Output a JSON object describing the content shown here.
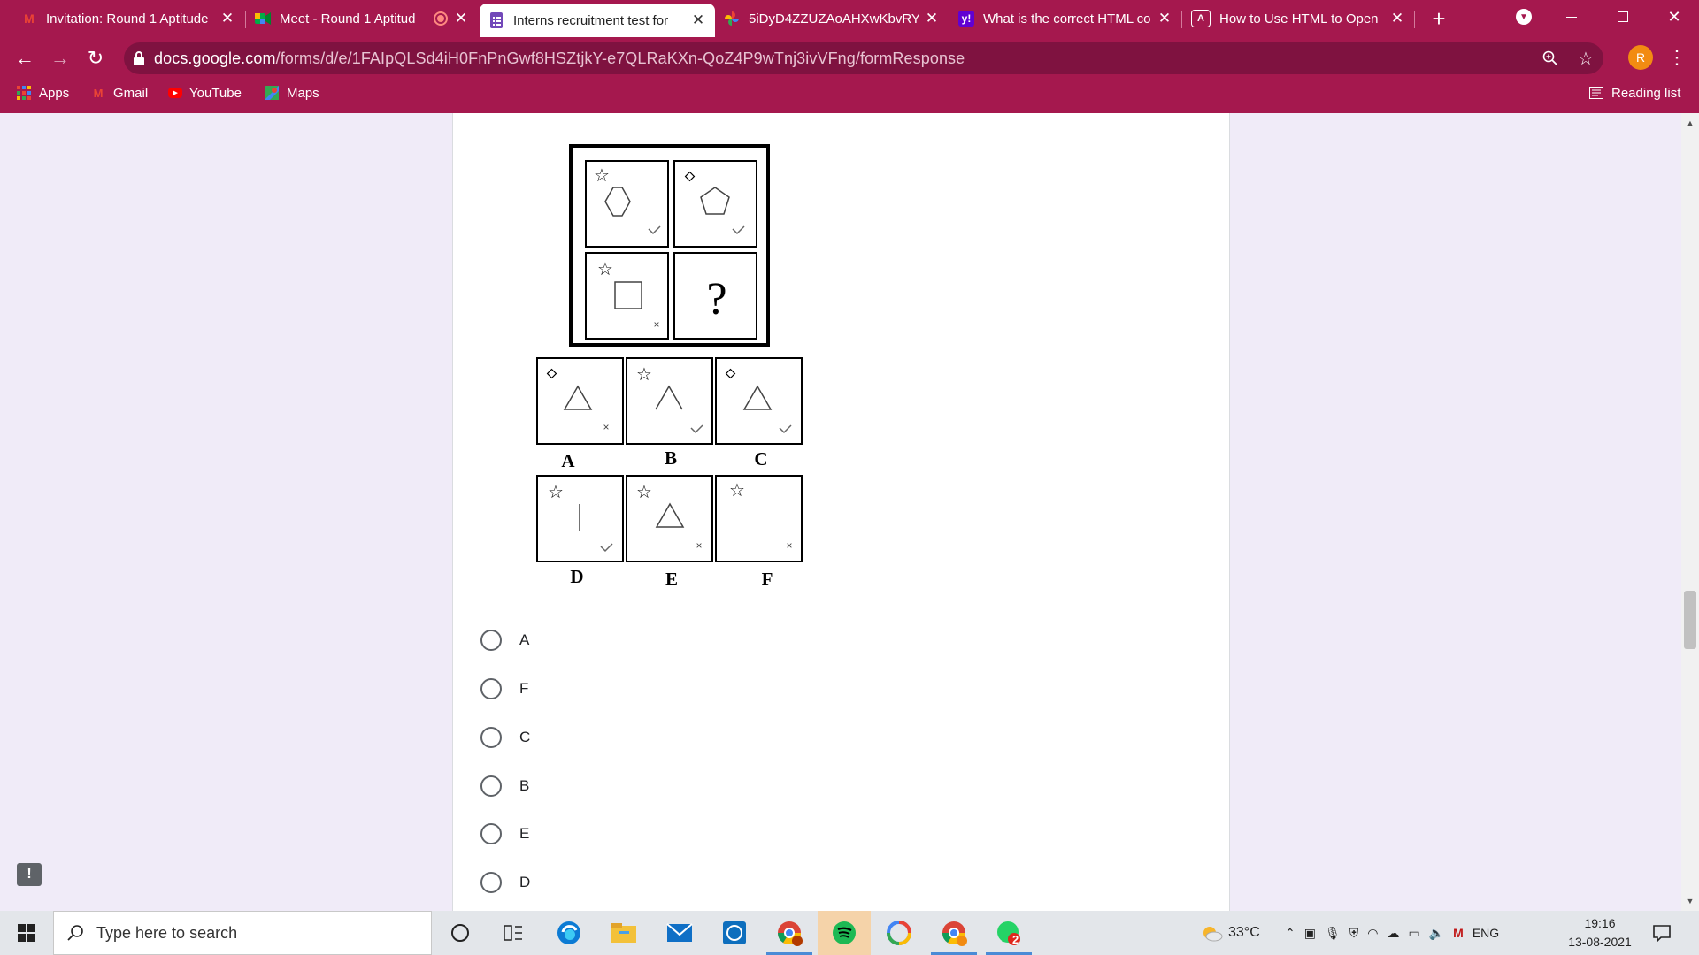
{
  "browser": {
    "tabs": [
      {
        "icon": "gmail-icon",
        "title": "Invitation: Round 1 Aptitude",
        "active": false
      },
      {
        "icon": "meet-icon",
        "title": "Meet - Round 1 Aptitud",
        "active": false
      },
      {
        "icon": "forms-icon",
        "title": "Interns recruitment test for",
        "active": true
      },
      {
        "icon": "photos-icon",
        "title": "5iDyD4ZZUZAoAHXwKbvRY",
        "active": false
      },
      {
        "icon": "yahoo-icon",
        "title": "What is the correct HTML co",
        "active": false
      },
      {
        "icon": "a-icon",
        "title": "How to Use HTML to Open",
        "active": false
      }
    ],
    "url_host": "docs.google.com",
    "url_path": "/forms/d/e/1FAIpQLSd4iH0FnPnGwf8HSZtjkY-e7QLRaKXn-QoZ4P9wTnj3ivVFng/formResponse",
    "profile_initial": "R",
    "bookmarks": [
      "Apps",
      "Gmail",
      "YouTube",
      "Maps"
    ],
    "reading_list": "Reading list",
    "colors": {
      "theme": "#a5184e",
      "omnibox": "#7f1240"
    }
  },
  "question": {
    "puzzle_mark": "?",
    "answer_labels": [
      "A",
      "B",
      "C",
      "D",
      "E",
      "F"
    ],
    "options": [
      "A",
      "F",
      "C",
      "B",
      "E",
      "D"
    ]
  },
  "feedback_icon": "!",
  "taskbar": {
    "search_placeholder": "Type here to search",
    "temperature": "33°C",
    "language": "ENG",
    "time": "19:16",
    "date": "13-08-2021",
    "whatsapp_badge": "2"
  }
}
